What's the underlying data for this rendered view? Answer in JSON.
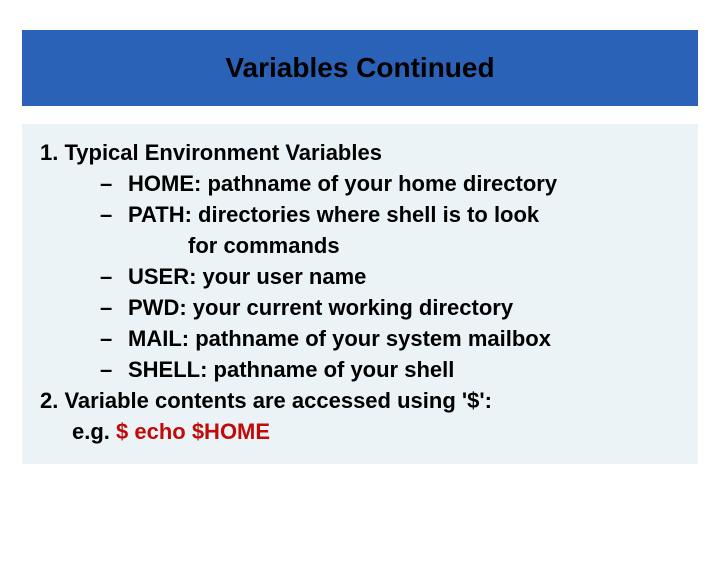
{
  "title": "Variables Continued",
  "item1_heading": "1. Typical Environment Variables",
  "env": {
    "home": "HOME: pathname of your home directory",
    "path_line1": "PATH: directories where shell is to look",
    "path_line2": "for commands",
    "user": "USER: your user name",
    "pwd": "PWD: your current working directory",
    "mail": "MAIL: pathname of your system mailbox",
    "shell": "SHELL: pathname of your shell"
  },
  "item2_heading": "2. Variable contents are accessed using '$':",
  "eg_prefix": "e.g. ",
  "eg_command": "$ echo $HOME",
  "dash": "–"
}
